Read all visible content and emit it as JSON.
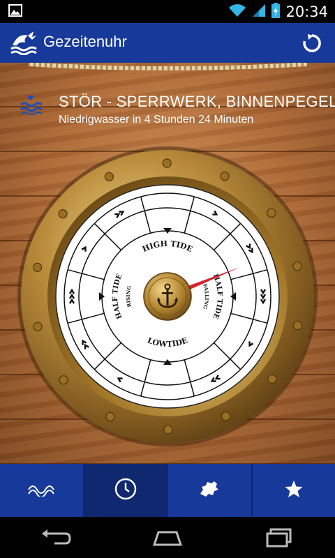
{
  "status_bar": {
    "time": "20:34",
    "icons": [
      "image-notification-icon",
      "wifi-icon",
      "signal-icon",
      "battery-charging-icon"
    ]
  },
  "app_bar": {
    "title": "Gezeitenuhr",
    "logo_icon": "tide-logo-icon",
    "action_icon": "refresh-icon"
  },
  "station": {
    "name": "STÖR - SPERRWERK, BINNENPEGEL",
    "status": "Niedrigwasser in 4 Stunden 24 Minuten",
    "icon": "water-level-icon"
  },
  "dial": {
    "high_tide_label": "HIGH TIDE",
    "low_tide_label": "LOWTIDE",
    "half_tide_rising_label": "HALF TIDE",
    "rising_label": "RISING",
    "half_tide_falling_label": "HALF TIDE",
    "falling_label": "FALLING",
    "center_icon": "anchor-icon",
    "hand_angle_degrees": 68
  },
  "bottom_nav": {
    "tabs": [
      {
        "icon": "tide-curve-icon",
        "active": false
      },
      {
        "icon": "clock-icon",
        "active": true
      },
      {
        "icon": "europe-map-icon",
        "active": false
      },
      {
        "icon": "star-icon",
        "active": false
      }
    ]
  },
  "colors": {
    "app_bar": "#17399a",
    "hand": "#d8222b",
    "brass": "#b88a3a"
  }
}
